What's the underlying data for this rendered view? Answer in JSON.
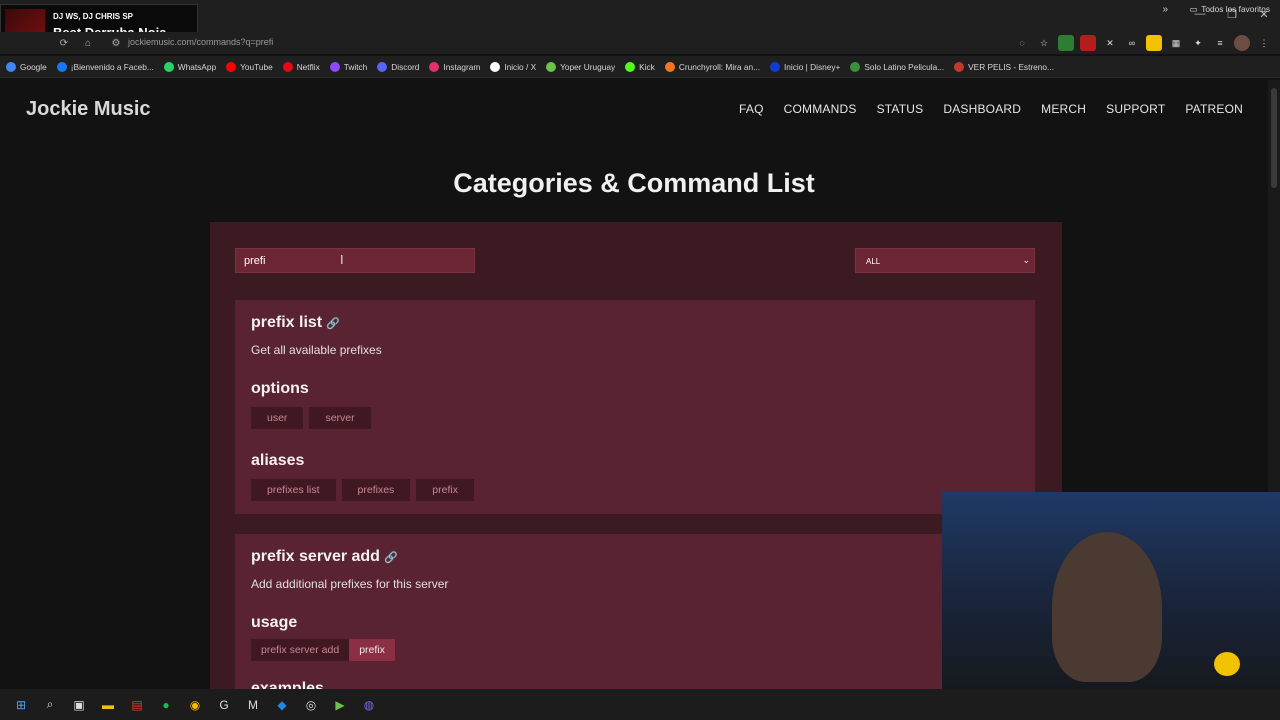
{
  "overlay": {
    "line1": "DJ WS, DJ CHRIS SP",
    "line2": "Beat Derruba Noia"
  },
  "browser": {
    "url": "jockiemusic.com/commands?q=prefi",
    "bookmarks": [
      "Google",
      "¡Bienvenido a Faceb...",
      "WhatsApp",
      "YouTube",
      "Netflix",
      "Twitch",
      "Discord",
      "Instagram",
      "Inicio / X",
      "Yoper Uruguay",
      "Kick",
      "Crunchyroll: Mira an...",
      "Inicio | Disney+",
      "Solo Latino Pelicula...",
      "VER PELIS - Estreno..."
    ],
    "bookmark_colors": [
      "#4285f4",
      "#1877f2",
      "#25d366",
      "#ff0000",
      "#e50914",
      "#9146ff",
      "#5865f2",
      "#e1306c",
      "#ffffff",
      "#6cc24a",
      "#53fc18",
      "#f47521",
      "#113ccf",
      "#3a8f3a",
      "#c0392b"
    ],
    "all_bookmarks": "Todos los favoritos"
  },
  "site": {
    "logo": "Jockie Music",
    "nav": [
      "FAQ",
      "COMMANDS",
      "STATUS",
      "DASHBOARD",
      "MERCH",
      "SUPPORT",
      "PATREON"
    ]
  },
  "page": {
    "title": "Categories & Command List",
    "search_value": "prefi",
    "category_select": "ALL"
  },
  "commands": [
    {
      "name": "prefix list",
      "description": "Get all available prefixes",
      "options_label": "options",
      "options": [
        "user",
        "server"
      ],
      "aliases_label": "aliases",
      "aliases": [
        "prefixes list",
        "prefixes",
        "prefix"
      ]
    },
    {
      "name": "prefix server add",
      "description": "Add additional prefixes for this server",
      "usage_label": "usage",
      "usage": [
        "prefix server add",
        "prefix"
      ],
      "next_label": "examples"
    }
  ],
  "colors": {
    "panel": "#3b1a22",
    "card": "#5a2331",
    "input": "#6b2535",
    "chip": "#3f1822",
    "chip_highlight": "#8a2f44"
  }
}
